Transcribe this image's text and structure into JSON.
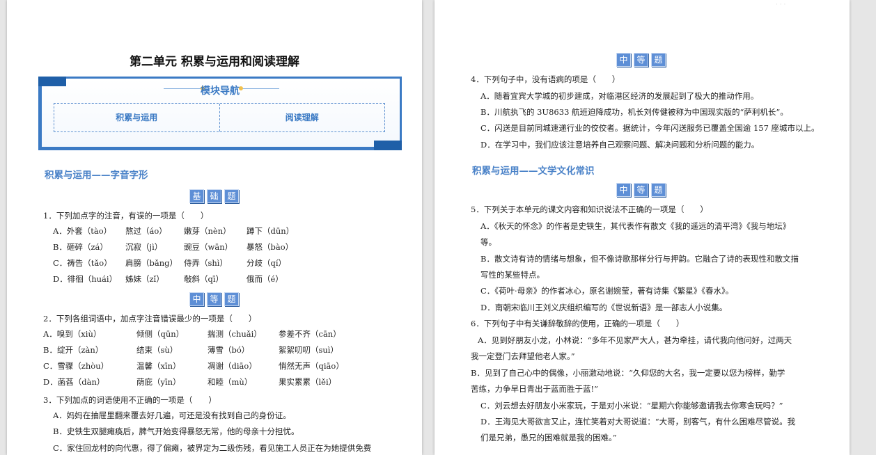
{
  "left": {
    "title": "第二单元 积累与运用和阅读理解",
    "nav": {
      "title": "模块导航",
      "items": [
        "积累与运用",
        "阅读理解"
      ]
    },
    "section1": "积累与运用——字音字形",
    "level_basic": [
      "基",
      "础",
      "题"
    ],
    "level_mid": [
      "中",
      "等",
      "题"
    ],
    "q1": {
      "stem": "1．下列加点字的注音，有误的一项是（　　）",
      "rows": [
        [
          "A．外套（tào）",
          "熬过（áo）",
          "嫩芽（nèn）",
          "蹲下（dūn）"
        ],
        [
          "B．砸碎（zá）",
          "沉寂（jì）",
          "豌豆（wān）",
          "暴怒（bào）"
        ],
        [
          "C．祷告（tǎo）",
          "肩膀（bǎng）",
          "侍弄（shì）",
          "分歧（qí）"
        ],
        [
          "D．徘徊（huái）",
          "姊妹（zǐ）",
          "敧斜（qī）",
          "俄而（é）"
        ]
      ]
    },
    "q2": {
      "stem": "2．下列各组词语中，加点字注音错误最少的一项是（　　）",
      "rows": [
        [
          "A．嗅到（xiù）",
          "倾侧（qūn）",
          "揣测（chuǎi）",
          "参差不齐（cān）"
        ],
        [
          "B．绽开（zàn）",
          "结束（sù）",
          "薄雪（bó）",
          "絮絮叨叨（suì）"
        ],
        [
          "C．雪骤（zhòu）",
          "温馨（xīn）",
          "凋谢（diāo）",
          "悄然无声（qiāo）"
        ],
        [
          "D．菡萏（dàn）",
          "荫庇（yīn）",
          "和睦（mù）",
          "果实累累（lěi）"
        ]
      ]
    },
    "q3": {
      "stem": "3．下列加点的词语使用不正确的一项是（　　）",
      "opts": [
        "A．妈妈在抽屉里翻来覆去好几遍，可还是没有找到自己的身份证。",
        "B．史铁生双腿瘫痪后，脾气开始变得暴怒无常，他的母亲十分担忧。",
        "C．家住回龙村的向代惠，得了偏瘫，被界定为二级伤残，看见施工人员正在为她提供免费"
      ]
    }
  },
  "right": {
    "faint": "· · ·",
    "level_mid": [
      "中",
      "等",
      "题"
    ],
    "q4": {
      "stem": "4．下列句子中，没有语病的项是（　　）",
      "opts": [
        "A．随着宜宾大学城的初步建成，对临港区经济的发展起到了极大的推动作用。",
        "B．川航执飞的 3U8633 航班迫降成功，机长刘传健被称为中国现实版的“萨利机长”。",
        "C．闪送是目前同城速递行业的佼佼者。据统计，今年闪送服务已覆盖全国逾 157 座城市以上。",
        "D．在学习中，我们应该注意培养自己观察问题、解决问题和分析问题的能力。"
      ]
    },
    "section2": "积累与运用——文学文化常识",
    "q5": {
      "stem": "5．下列关于本单元的课文内容和知识说法不正确的一项是（　　）",
      "lines": [
        "A．《秋天的怀念》的作者是史铁生，其代表作有散文《我的遥远的清平湾》《我与地坛》",
        "等。",
        "B．散文诗有诗的情绪与想象，但不像诗歌那样分行与押韵。它融合了诗的表现性和散文描",
        "写性的某些特点。",
        "C．《荷叶·母亲》的作者冰心，原名谢婉莹，著有诗集《繁星》《春水》。",
        "D．南朝宋临川王刘义庆组织编写的《世说新语》是一部志人小说集。"
      ]
    },
    "q6": {
      "stem": "6．下列句子中有关谦辞敬辞的使用，正确的一项是（　　）",
      "lines": [
        "A．见到好朋友小龙，小林说：“多年不见家严大人，甚为牵挂，请代我向他问好，过两天",
        "我一定登门去拜望他老人家。”",
        "B．见到了自己心中的偶像，小丽激动地说：“久仰您的大名，我一定要以您为榜样，勤学",
        "苦练，力争早日青出于蓝而胜于蓝!”",
        "C．刘云想去好朋友小米家玩，于是对小米说：“星期六你能够邀请我去你寒舍玩吗？”",
        "D．王海见大哥欲言又止，连忙笑着对大哥说道：“大哥，别客气，有什么困难尽管说。我",
        "们是兄弟，愚兄的困难就是我的困难。”"
      ]
    }
  }
}
